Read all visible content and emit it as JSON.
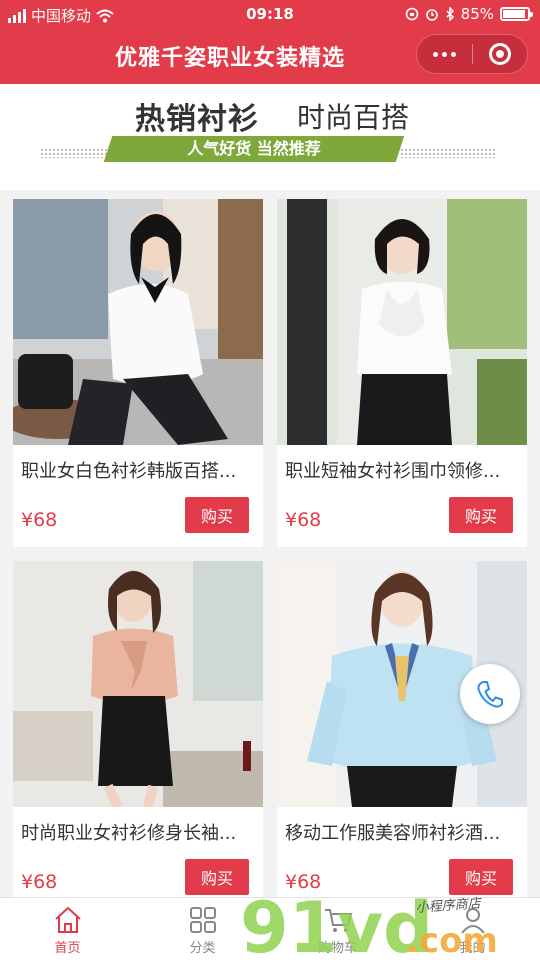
{
  "status": {
    "carrier": "中国移动",
    "time": "09:18",
    "battery": "85%"
  },
  "nav": {
    "title": "优雅千姿职业女装精选"
  },
  "banner": {
    "title": "热销衬衫",
    "title2": "时尚百搭",
    "subtitle": "人气好货 当然推荐"
  },
  "products": [
    {
      "name": "职业女白色衬衫韩版百搭...",
      "price": "¥68",
      "buy": "购买"
    },
    {
      "name": "职业短袖女衬衫围巾领修...",
      "price": "¥68",
      "buy": "购买"
    },
    {
      "name": "时尚职业女衬衫修身长袖...",
      "price": "¥68",
      "buy": "购买"
    },
    {
      "name": "移动工作服美容师衬衫酒...",
      "price": "¥68",
      "buy": "购买"
    }
  ],
  "tabs": [
    {
      "label": "首页",
      "icon": "home-icon",
      "active": true
    },
    {
      "label": "分类",
      "icon": "grid-icon",
      "active": false
    },
    {
      "label": "购物车",
      "icon": "cart-icon",
      "active": false
    },
    {
      "label": "我的",
      "icon": "user-icon",
      "active": false
    }
  ],
  "watermark": {
    "text": "91vd",
    "domain": ".com",
    "note": "小程序商店"
  },
  "colors": {
    "brand": "#e23c4b",
    "banner_stripe": "#7fa83a"
  }
}
